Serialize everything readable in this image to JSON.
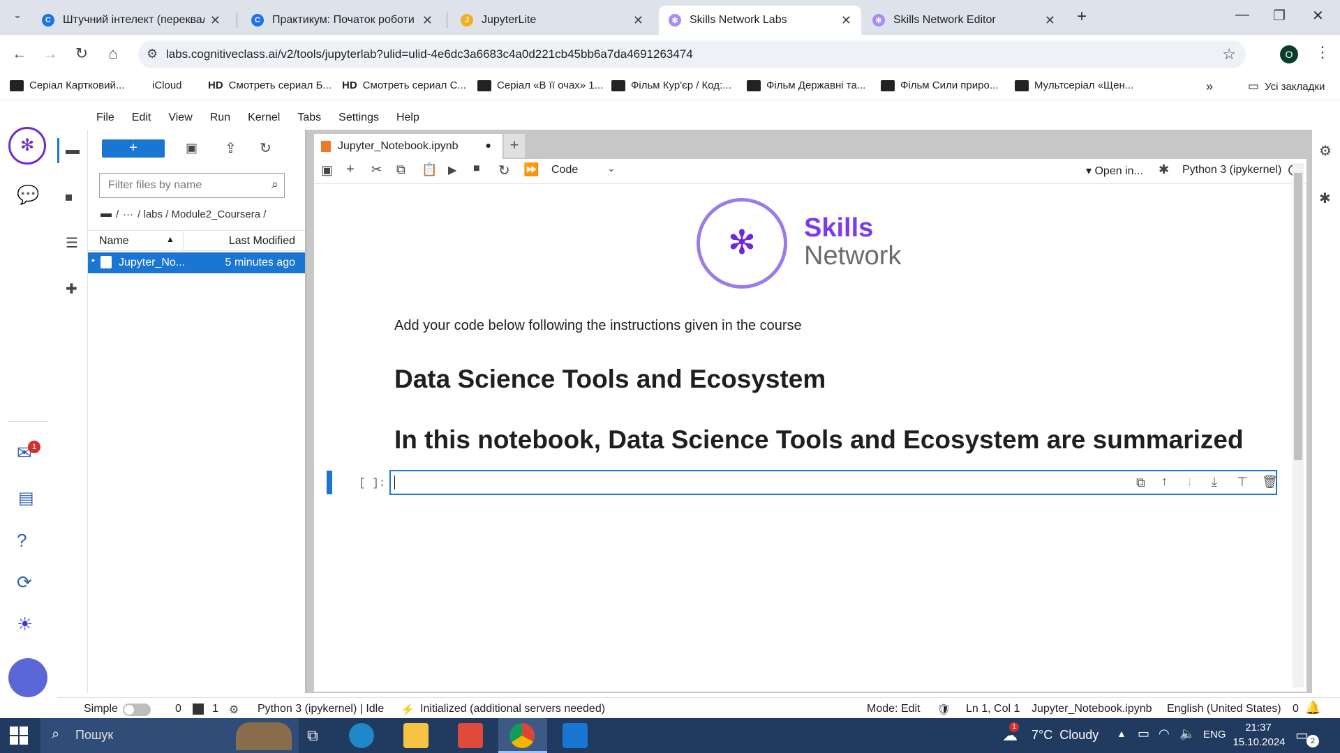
{
  "browser": {
    "tabs": [
      {
        "title": "Штучний інтелект (перекваліф",
        "active": false
      },
      {
        "title": "Практикум: Початок роботи з",
        "active": false
      },
      {
        "title": "JupyterLite",
        "active": false
      },
      {
        "title": "Skills Network Labs",
        "active": true
      },
      {
        "title": "Skills Network Editor",
        "active": false
      }
    ],
    "url": "labs.cognitiveclass.ai/v2/tools/jupyterlab?ulid=ulid-4e6dc3a6683c4a0d221cb45bb6a7da4691263474",
    "profile_initial": "O",
    "bookmarks": [
      "Серіал Картковий...",
      "iCloud",
      "Смотреть сериал Б...",
      "Смотреть сериал С...",
      "Серіал «В її очах» 1...",
      "Фільм Кур'єр / Код:...",
      "Фільм Державні та...",
      "Фільм Сили приро...",
      "Мультсеріал «Щен..."
    ],
    "bookmark_hd_label": "HD",
    "all_bookmarks": "Усі закладки"
  },
  "jupyter": {
    "menu": [
      "File",
      "Edit",
      "View",
      "Run",
      "Kernel",
      "Tabs",
      "Settings",
      "Help"
    ],
    "new_button": "+",
    "filter_placeholder": "Filter files by name",
    "breadcrumb": {
      "root": "/",
      "ellipsis": "···",
      "path": "/ labs / Module2_Coursera /"
    },
    "file_columns": {
      "name": "Name",
      "modified": "Last Modified"
    },
    "files": [
      {
        "name": "Jupyter_No...",
        "modified": "5 minutes ago"
      }
    ],
    "doc_tab": "Jupyter_Notebook.ipynb",
    "cell_type": "Code",
    "open_in": "Open in...",
    "kernel": "Python 3 (ipykernel)",
    "notebook": {
      "logo_line1": "Skills",
      "logo_line2": "Network",
      "instruction": "Add your code below following the instructions given in the course",
      "heading1": "Data Science Tools and Ecosystem",
      "heading2": "In this notebook, Data Science Tools and Ecosystem are summarized",
      "cell_prompt": "[ ]:"
    },
    "notification_count": "1",
    "status": {
      "simple": "Simple",
      "count0": "0",
      "count1": "1",
      "kernel_state": "Python 3 (ipykernel) | Idle",
      "lsp": "Initialized (additional servers needed)",
      "mode": "Mode: Edit",
      "position": "Ln 1, Col 1",
      "file": "Jupyter_Notebook.ipynb",
      "language": "English (United States)",
      "bell_count": "0"
    }
  },
  "taskbar": {
    "search": "Пошук",
    "weather": "7°C  Cloudy",
    "weather_badge": "1",
    "lang": "ENG",
    "time": "21:37",
    "date": "15.10.2024",
    "notif_count": "2"
  },
  "colors": {
    "accent": "#1976d2",
    "skills_purple": "#7c3aed",
    "taskbar": "#203a60"
  }
}
